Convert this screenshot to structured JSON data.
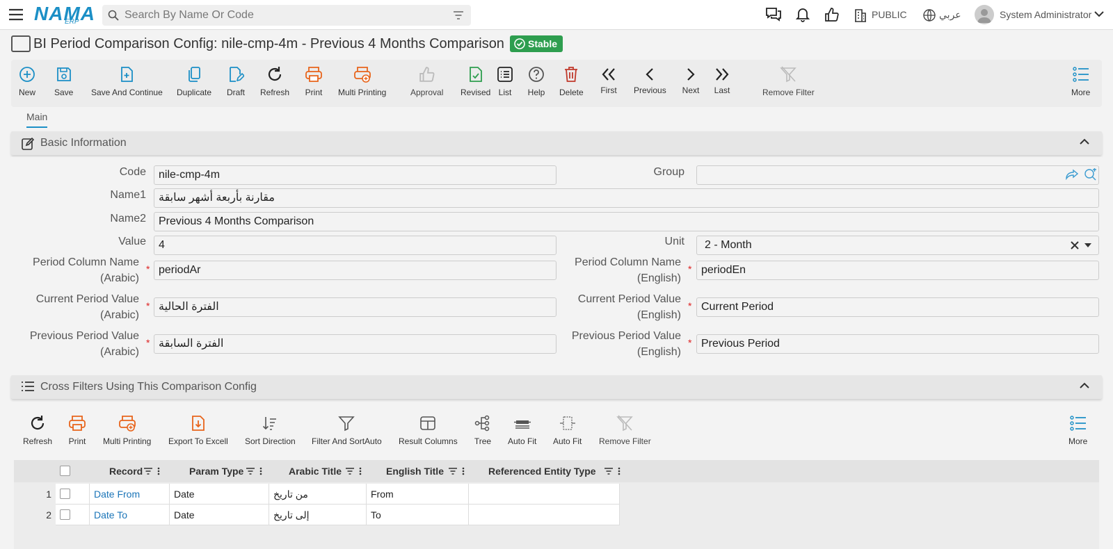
{
  "topbar": {
    "logo": "NAMA",
    "logo_sub": "ERP",
    "search_placeholder": "Search By Name Or Code",
    "tenant": "PUBLIC",
    "language": "عربي",
    "user": "System Administrator",
    "icons": [
      "menu-icon",
      "search-icon",
      "filter-icon",
      "chat-icon",
      "bell-icon",
      "thumbs-up-icon",
      "building-icon",
      "globe-icon",
      "user-avatar-icon",
      "chevron-down-icon"
    ]
  },
  "page": {
    "title": "BI Period Comparison Config: nile-cmp-4m - Previous 4 Months Comparison",
    "status": "Stable"
  },
  "toolbar": {
    "buttons": [
      {
        "label": "New",
        "icon": "plus-circle-icon",
        "color": "#1b8fc6"
      },
      {
        "label": "Save",
        "icon": "save-icon",
        "color": "#1b8fc6"
      },
      {
        "label": "Save And Continue",
        "icon": "save-continue-icon",
        "color": "#1b8fc6"
      },
      {
        "label": "Duplicate",
        "icon": "duplicate-icon",
        "color": "#1b8fc6"
      },
      {
        "label": "Draft",
        "icon": "draft-icon",
        "color": "#1b8fc6"
      },
      {
        "label": "Refresh",
        "icon": "refresh-icon",
        "color": "#222222"
      },
      {
        "label": "Print",
        "icon": "print-icon",
        "color": "#e8641b"
      },
      {
        "label": "Multi Printing",
        "icon": "multi-print-icon",
        "color": "#e8641b"
      },
      {
        "label": "Approval",
        "icon": "thumbs-up-icon",
        "color": "#bbbbbb"
      },
      {
        "label": "Revised",
        "icon": "revised-icon",
        "color": "#2e9e4f"
      },
      {
        "label": "List",
        "icon": "list-icon",
        "color": "#222222"
      },
      {
        "label": "Help",
        "icon": "help-icon",
        "color": "#555555"
      },
      {
        "label": "Delete",
        "icon": "trash-icon",
        "color": "#c0392b"
      },
      {
        "label": "First",
        "icon": "double-chevron-left-icon",
        "color": "#222222"
      },
      {
        "label": "Previous",
        "icon": "chevron-left-icon",
        "color": "#222222"
      },
      {
        "label": "Next",
        "icon": "chevron-right-icon",
        "color": "#222222"
      },
      {
        "label": "Last",
        "icon": "double-chevron-right-icon",
        "color": "#222222"
      },
      {
        "label": "Remove Filter",
        "icon": "remove-filter-icon",
        "color": "#bbbbbb"
      }
    ],
    "more_label": "More"
  },
  "tabs": [
    {
      "label": "Main"
    }
  ],
  "basic_section": {
    "title": "Basic Information",
    "fields": {
      "code": {
        "label": "Code",
        "value": "nile-cmp-4m"
      },
      "group": {
        "label": "Group",
        "value": ""
      },
      "name1": {
        "label": "Name1",
        "value": "مقارنة بأربعة أشهر سابقة"
      },
      "name2": {
        "label": "Name2",
        "value": "Previous 4 Months Comparison"
      },
      "value": {
        "label": "Value",
        "value": "4"
      },
      "unit": {
        "label": "Unit",
        "value": "2 - Month"
      },
      "period_col_ar": {
        "label_l1": "Period Column Name",
        "label_l2": "(Arabic)",
        "value": "periodAr"
      },
      "period_col_en": {
        "label_l1": "Period Column Name",
        "label_l2": "(English)",
        "value": "periodEn"
      },
      "current_ar": {
        "label_l1": "Current Period Value",
        "label_l2": "(Arabic)",
        "value": "الفترة الحالية"
      },
      "current_en": {
        "label_l1": "Current Period Value",
        "label_l2": "(English)",
        "value": "Current Period"
      },
      "previous_ar": {
        "label_l1": "Previous Period Value",
        "label_l2": "(Arabic)",
        "value": "الفترة السابقة"
      },
      "previous_en": {
        "label_l1": "Previous Period Value",
        "label_l2": "(English)",
        "value": "Previous Period"
      }
    }
  },
  "cross_section": {
    "title": "Cross Filters Using This Comparison Config",
    "toolbar": [
      {
        "label": "Refresh",
        "icon": "refresh-icon",
        "color": "#222222"
      },
      {
        "label": "Print",
        "icon": "print-icon",
        "color": "#e8641b"
      },
      {
        "label": "Multi Printing",
        "icon": "multi-print-icon",
        "color": "#e8641b"
      },
      {
        "label": "Export To Excell",
        "icon": "export-excel-icon",
        "color": "#e8641b"
      },
      {
        "label": "Sort Direction",
        "icon": "sort-direction-icon",
        "color": "#555555"
      },
      {
        "label": "Filter And SortAuto",
        "icon": "funnel-icon",
        "color": "#555555"
      },
      {
        "label": "Result Columns",
        "icon": "columns-icon",
        "color": "#555555"
      },
      {
        "label": "Tree",
        "icon": "tree-icon",
        "color": "#555555"
      },
      {
        "label": "Auto Fit",
        "icon": "auto-fit-icon",
        "color": "#555555"
      },
      {
        "label": "Auto Fit",
        "icon": "auto-fit-alt-icon",
        "color": "#777777"
      },
      {
        "label": "Remove Filter",
        "icon": "remove-filter-icon",
        "color": "#bbbbbb"
      }
    ],
    "more_label": "More",
    "columns": [
      "Record",
      "Param Type",
      "Arabic Title",
      "English Title",
      "Referenced Entity Type"
    ],
    "rows": [
      {
        "num": "1",
        "record": "Date From",
        "param_type": "Date",
        "arabic_title": "من تاريخ",
        "english_title": "From",
        "ref_type": ""
      },
      {
        "num": "2",
        "record": "Date To",
        "param_type": "Date",
        "arabic_title": "إلى تاريخ",
        "english_title": "To",
        "ref_type": ""
      }
    ]
  }
}
